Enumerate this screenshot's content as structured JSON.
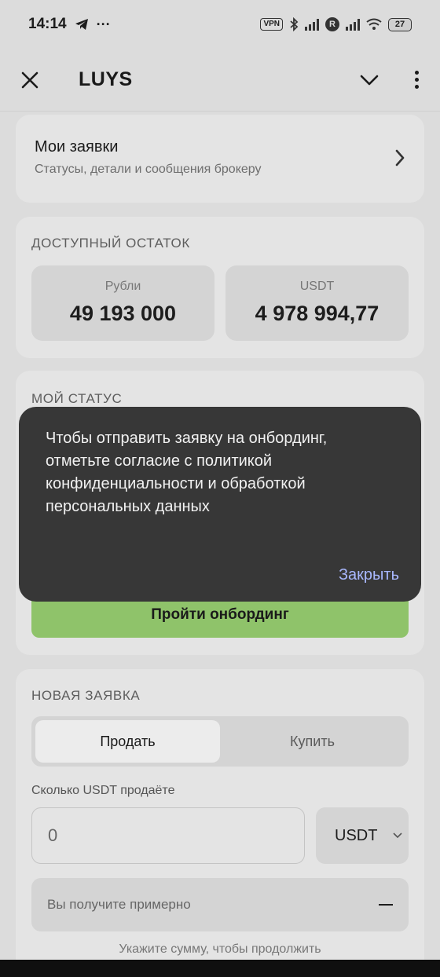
{
  "status_bar": {
    "time": "14:14",
    "vpn": "VPN",
    "roaming": "R",
    "battery": "27"
  },
  "app_bar": {
    "title": "LUYS"
  },
  "requests_card": {
    "title": "Мои заявки",
    "subtitle": "Статусы, детали и сообщения брокеру"
  },
  "balance": {
    "label": "ДОСТУПНЫЙ ОСТАТОК",
    "items": [
      {
        "label": "Рубли",
        "value": "49 193 000"
      },
      {
        "label": "USDT",
        "value": "4 978 994,77"
      }
    ]
  },
  "status": {
    "label": "МОЙ СТАТУС",
    "button": "Пройти онбординг"
  },
  "new_request": {
    "label": "НОВАЯ ЗАЯВКА",
    "tabs": [
      "Продать",
      "Купить"
    ],
    "amount_label": "Сколько USDT продаёте",
    "amount_placeholder": "0",
    "currency": "USDT",
    "receive_label": "Вы получите примерно",
    "hint": "Укажите сумму, чтобы продолжить"
  },
  "snackbar": {
    "message": "Чтобы отправить заявку на онбординг, отметьте согласие с политикой конфиденциальности и обработкой персональных данных",
    "action": "Закрыть"
  }
}
